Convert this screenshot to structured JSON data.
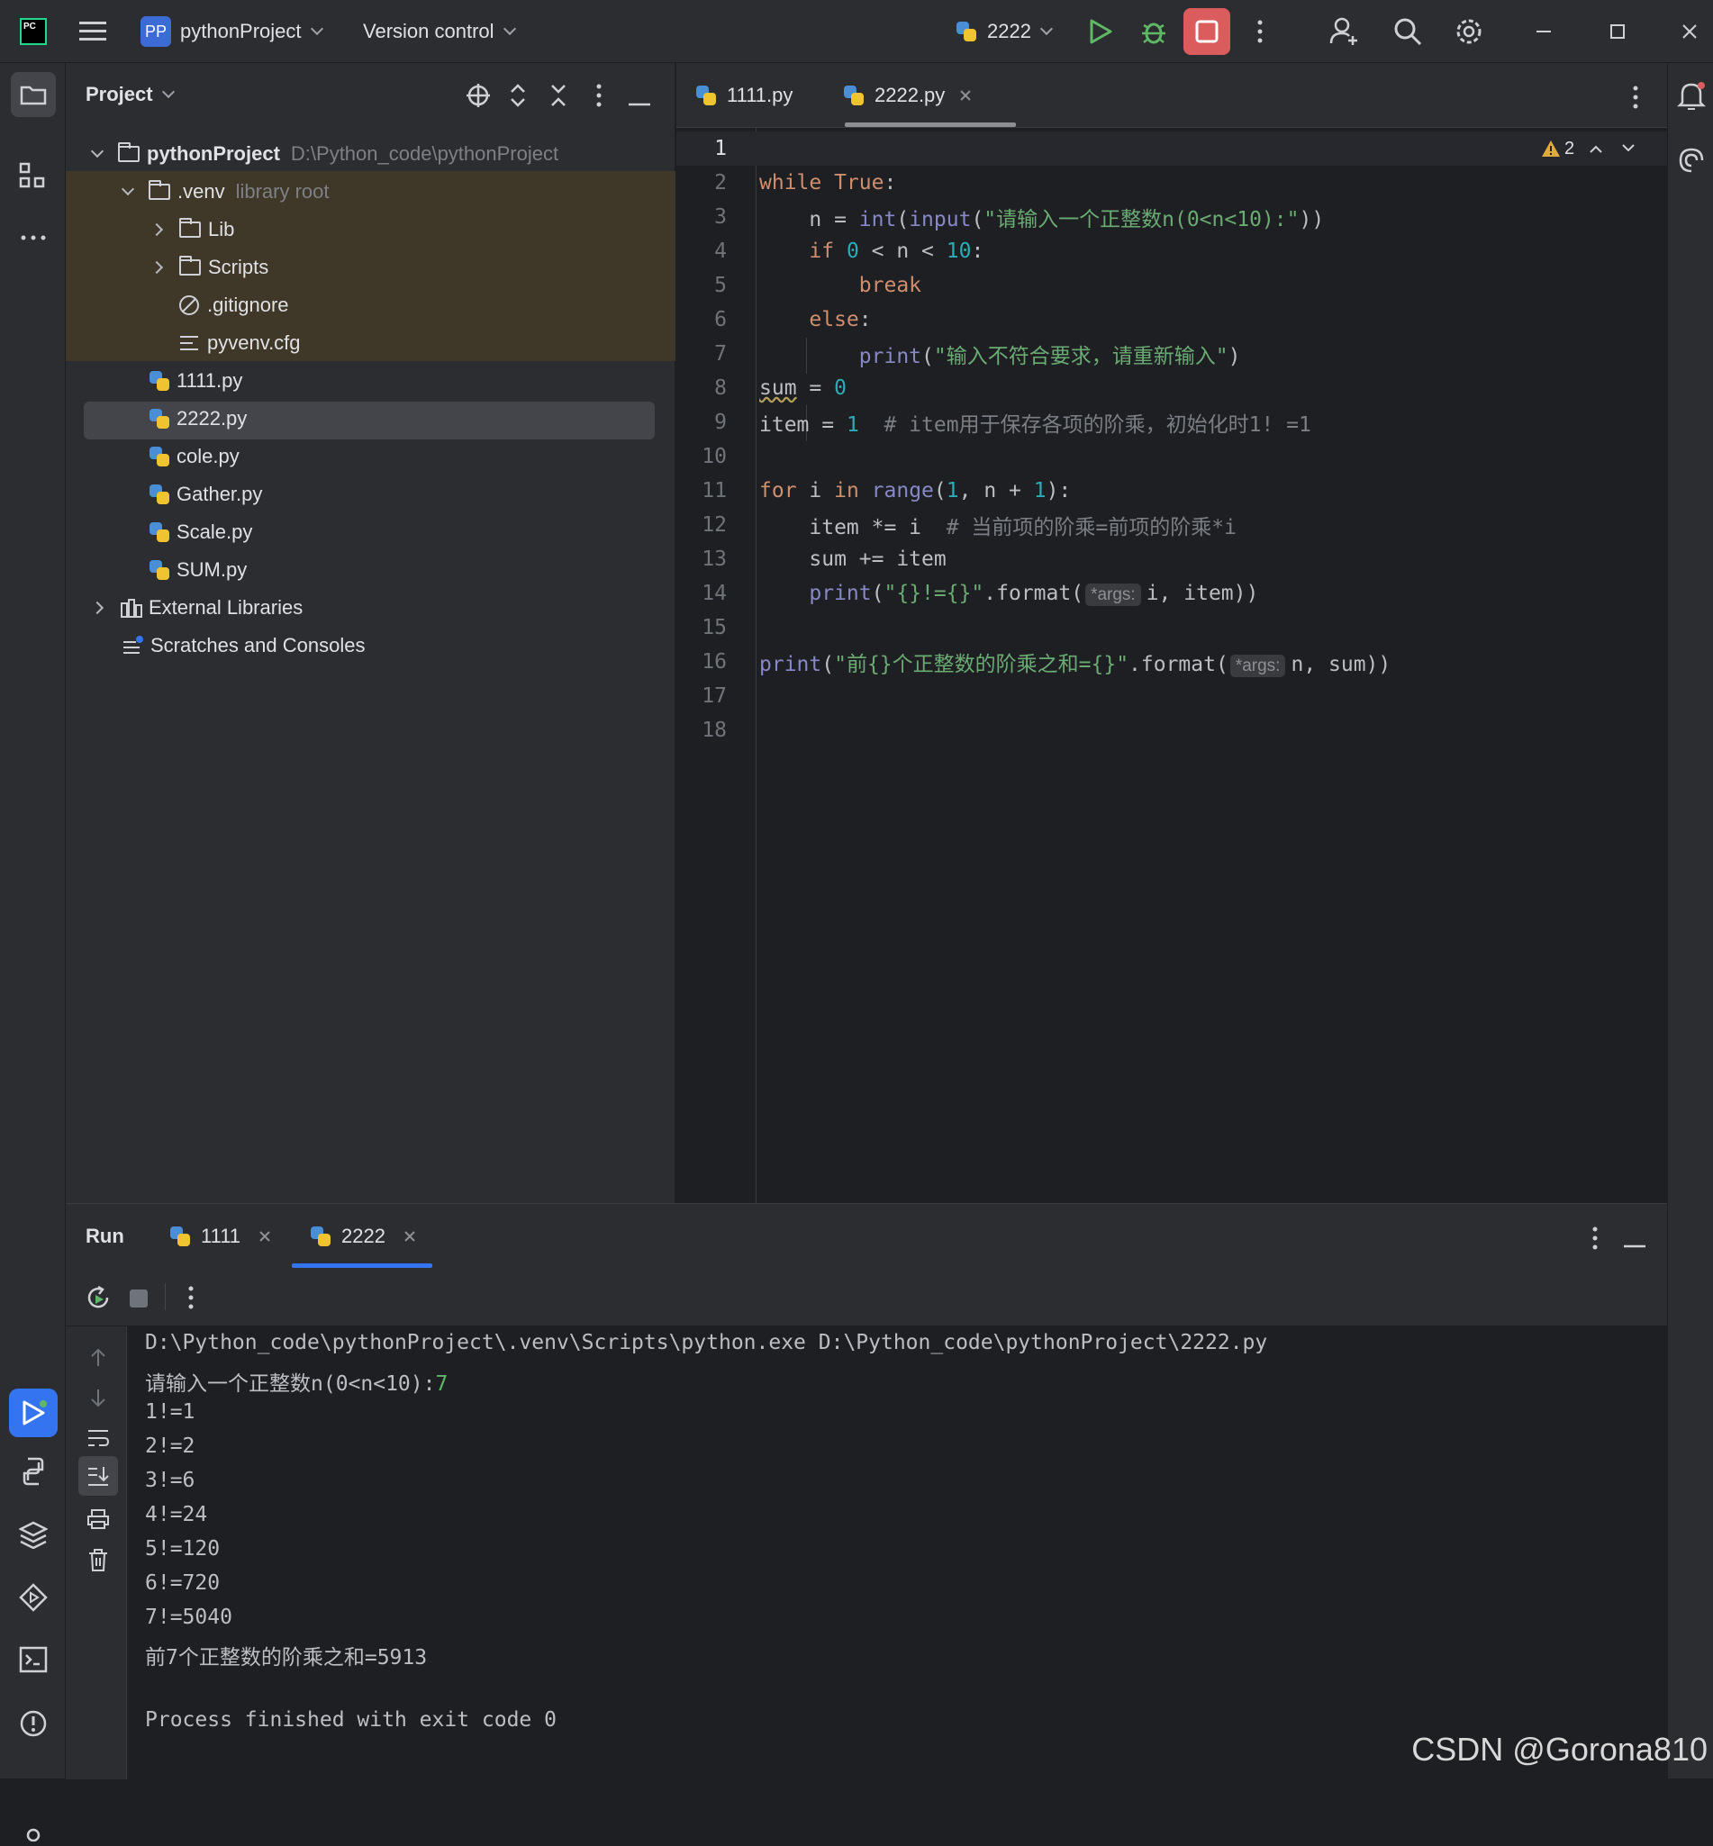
{
  "titlebar": {
    "logo_text": "PC",
    "project_badge": "PP",
    "project_name": "pythonProject",
    "version_control": "Version control",
    "run_config": "2222"
  },
  "project_panel": {
    "title": "Project",
    "root": {
      "name": "pythonProject",
      "path": "D:\\Python_code\\pythonProject"
    },
    "venv": {
      "name": ".venv",
      "hint": "library root"
    },
    "venv_items": [
      "Lib",
      "Scripts",
      ".gitignore",
      "pyvenv.cfg"
    ],
    "files": [
      "1111.py",
      "2222.py",
      "cole.py",
      "Gather.py",
      "Scale.py",
      "SUM.py"
    ],
    "external_libraries": "External Libraries",
    "scratches": "Scratches and Consoles"
  },
  "editor": {
    "tabs": [
      "1111.py",
      "2222.py"
    ],
    "active_tab": "2222.py",
    "warnings_count": "2",
    "line_numbers": [
      "1",
      "2",
      "3",
      "4",
      "5",
      "6",
      "7",
      "8",
      "9",
      "10",
      "11",
      "12",
      "13",
      "14",
      "15",
      "16",
      "17",
      "18"
    ],
    "code": {
      "l2_a": "while",
      "l2_b": "True",
      "l2_c": ":",
      "l3_a": "n = ",
      "l3_b": "int",
      "l3_c": "(",
      "l3_d": "input",
      "l3_e": "(",
      "l3_f": "\"请输入一个正整数n(0<n<10):\"",
      "l3_g": "))",
      "l4_a": "if ",
      "l4_b": "0",
      "l4_c": " < n < ",
      "l4_d": "10",
      "l4_e": ":",
      "l5": "break",
      "l6_a": "else",
      "l6_b": ":",
      "l7_a": "print",
      "l7_b": "(",
      "l7_c": "\"输入不符合要求，请重新输入\"",
      "l7_d": ")",
      "l8_a": "sum",
      "l8_b": " = ",
      "l8_c": "0",
      "l9_a": "item = ",
      "l9_b": "1",
      "l9_c": "  # item用于保存各项的阶乘，初始化时1! =1",
      "l11_a": "for",
      "l11_b": " i ",
      "l11_c": "in",
      "l11_d": " ",
      "l11_e": "range",
      "l11_f": "(",
      "l11_g": "1",
      "l11_h": ", n + ",
      "l11_i": "1",
      "l11_j": "):",
      "l12_a": "item *= i  ",
      "l12_b": "# 当前项的阶乘=前项的阶乘*i",
      "l13": "sum += item",
      "l14_a": "print",
      "l14_b": "(",
      "l14_c": "\"{}!={}\"",
      "l14_d": ".format(",
      "l14_hint": "*args:",
      "l14_e": "i, item))",
      "l16_a": "print",
      "l16_b": "(",
      "l16_c": "\"前{}个正整数的阶乘之和={}\"",
      "l16_d": ".format(",
      "l16_hint": "*args:",
      "l16_e": "n, sum))"
    }
  },
  "run_panel": {
    "title": "Run",
    "tabs": [
      "1111",
      "2222"
    ],
    "active_tab": "2222",
    "output": [
      "D:\\Python_code\\pythonProject\\.venv\\Scripts\\python.exe D:\\Python_code\\pythonProject\\2222.py",
      "请输入一个正整数n(0<n<10):",
      "1!=1",
      "2!=2",
      "3!=6",
      "4!=24",
      "5!=120",
      "6!=720",
      "7!=5040",
      "前7个正整数的阶乘之和=5913",
      "",
      "Process finished with exit code 0"
    ],
    "user_input": "7"
  },
  "watermark": "CSDN @Gorona810",
  "colors": {
    "accent": "#3574f0",
    "stop": "#db5c5c",
    "run": "#5fb865",
    "warning": "#e0a93c"
  }
}
